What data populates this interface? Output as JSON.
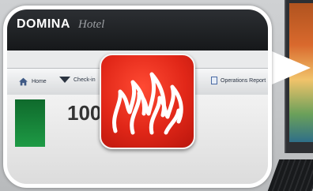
{
  "app": {
    "brand": "DOMINA",
    "brand_sub": "Hotel"
  },
  "nav": {
    "home": "Home",
    "check_in": "Check-in",
    "operations_report": "Operations Report"
  },
  "dashboard": {
    "count": "100"
  },
  "colors": {
    "fire_badge": "#e12718",
    "header": "#1f2225",
    "tile_green": "#1e9a45"
  },
  "icons": {
    "home": "home-icon",
    "dropdown": "triangle-down-icon",
    "report": "document-icon",
    "alert": "fire-icon"
  }
}
